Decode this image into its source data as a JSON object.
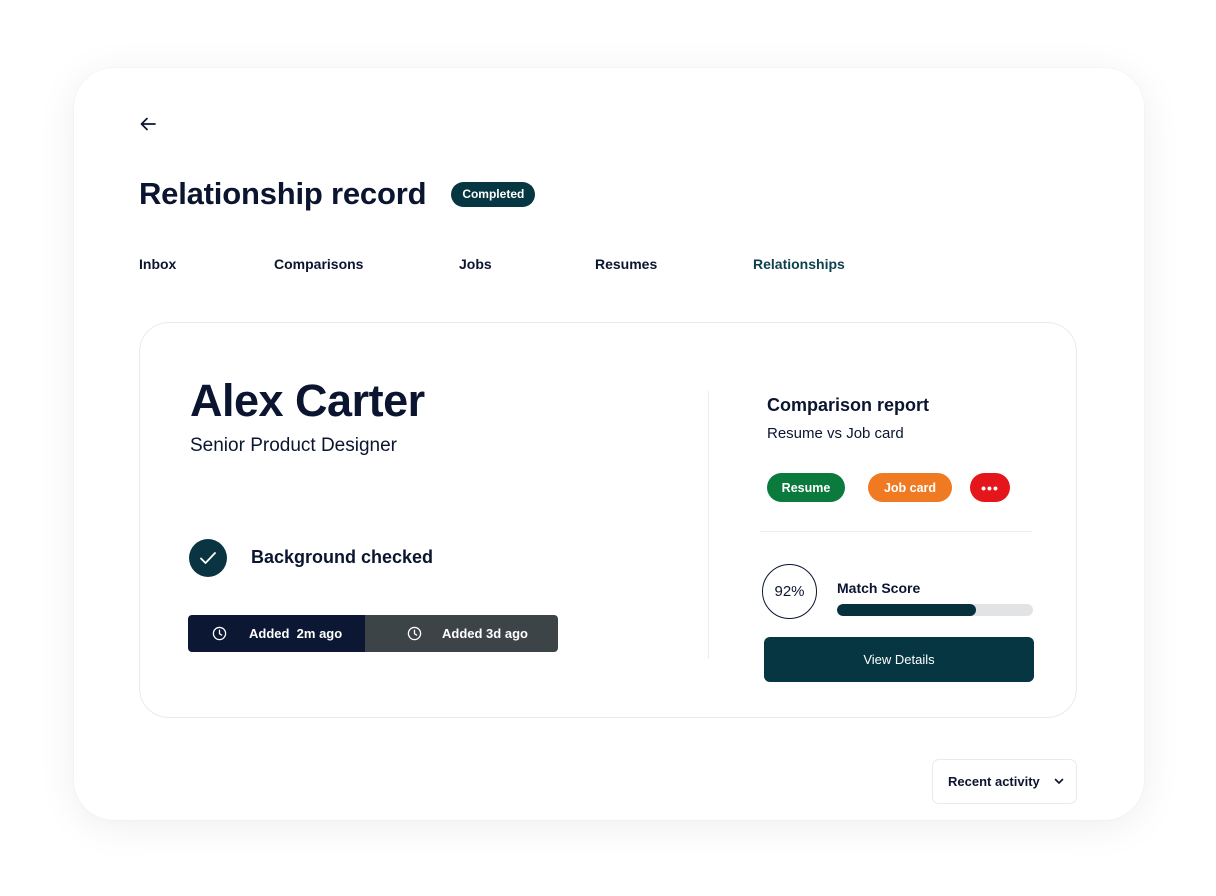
{
  "header": {
    "title": "Relationship record",
    "status": "Completed"
  },
  "tabs": [
    {
      "label": "Inbox",
      "active": false
    },
    {
      "label": "Comparisons",
      "active": false
    },
    {
      "label": "Jobs",
      "active": false
    },
    {
      "label": "Resumes",
      "active": false
    },
    {
      "label": "Relationships",
      "active": true
    }
  ],
  "profile": {
    "name": "Alex Carter",
    "role": "Senior Product Designer",
    "check_label": "Background checked",
    "added": [
      {
        "label": "Added  2m ago"
      },
      {
        "label": "Added 3d ago"
      }
    ]
  },
  "report": {
    "title": "Comparison report",
    "subtitle": "Resume vs Job card",
    "chips": [
      {
        "label": "Resume",
        "color": "#0a7a3d"
      },
      {
        "label": "Job card",
        "color": "#f07a22"
      },
      {
        "label": "•••",
        "color": "#e5161b"
      }
    ],
    "score_text": "92%",
    "score_label": "Match Score",
    "score_bar_fraction": 0.71,
    "button_label": "View Details"
  },
  "footer": {
    "dropdown_label": "Recent activity"
  },
  "colors": {
    "primary": "#063642",
    "navy": "#0b1733",
    "text": "#0b1530"
  },
  "icons": {
    "back": "arrow-left-icon",
    "check": "checkmark-icon",
    "clock": "clock-icon",
    "chevron": "chevron-down-icon"
  }
}
